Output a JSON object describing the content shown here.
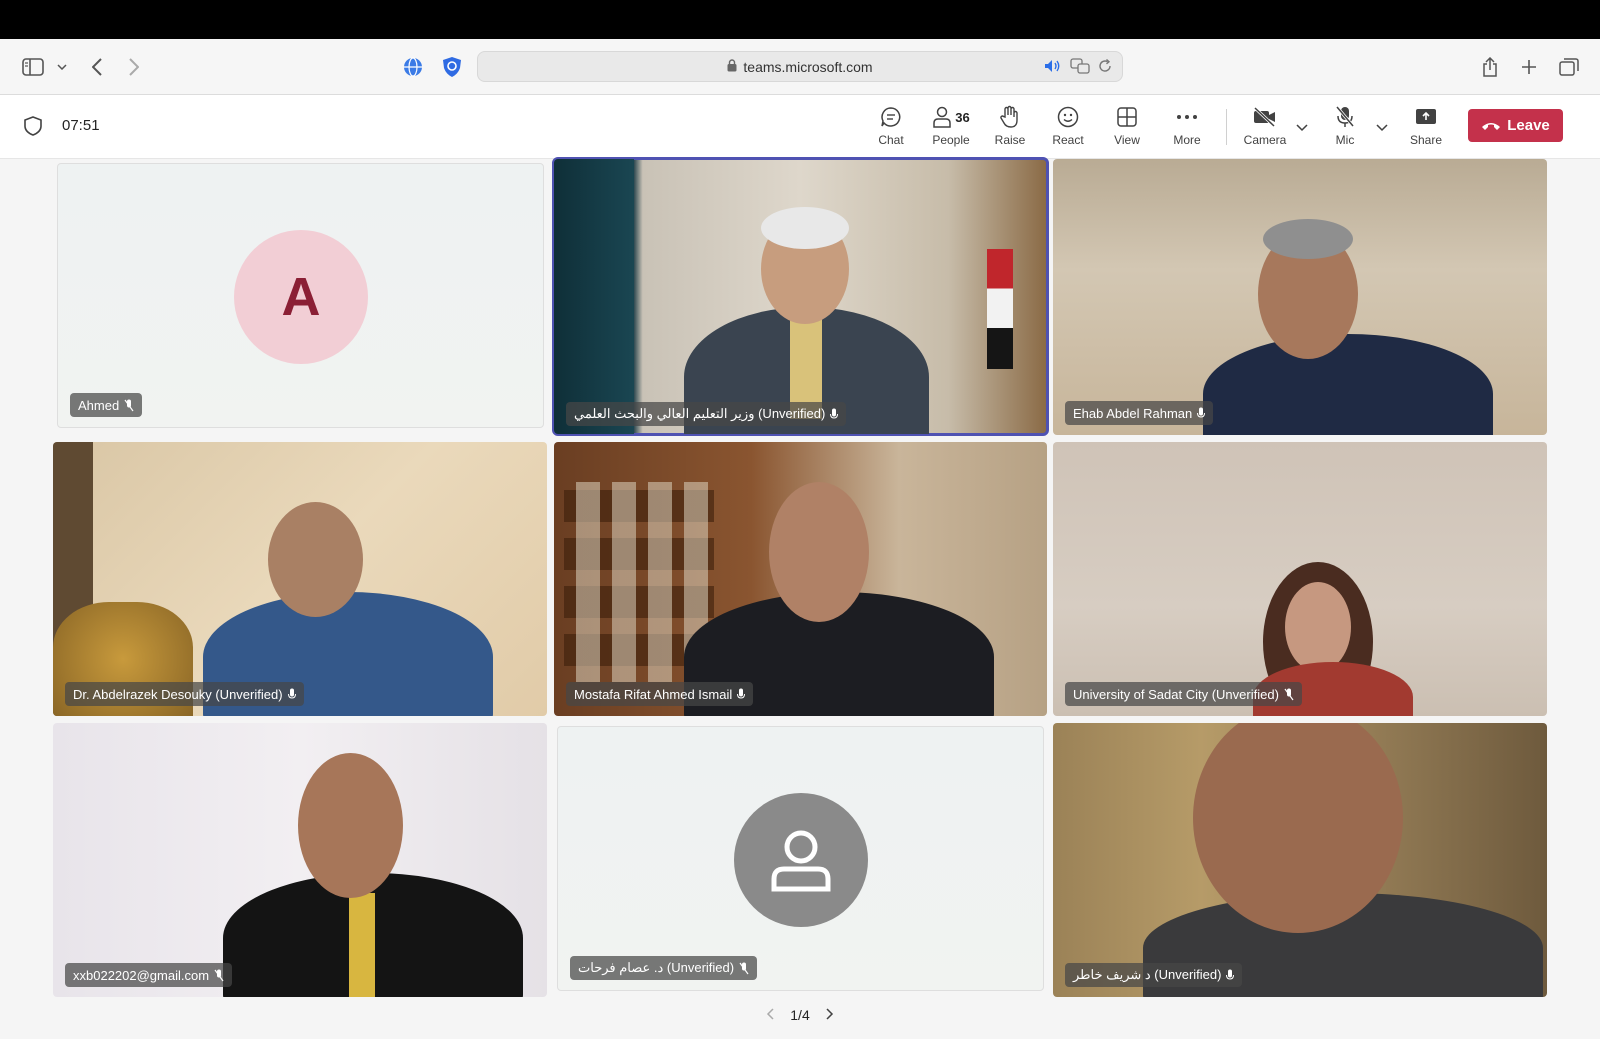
{
  "browser": {
    "url": "teams.microsoft.com"
  },
  "meeting": {
    "timer": "07:51",
    "toolbar": {
      "chat": "Chat",
      "people": "People",
      "people_count": "36",
      "raise": "Raise",
      "react": "React",
      "view": "View",
      "more": "More",
      "camera": "Camera",
      "mic": "Mic",
      "share": "Share",
      "leave": "Leave"
    },
    "accent_color": "#4f52b2",
    "leave_color": "#c4314b"
  },
  "participants": [
    {
      "name": "Ahmed",
      "avatar_initial": "A",
      "muted": true,
      "video": false
    },
    {
      "name": "وزير التعليم العالي والبحث العلمي (Unverified)",
      "muted": false,
      "video": true,
      "active_speaker": true
    },
    {
      "name": "Ehab Abdel Rahman",
      "muted": false,
      "video": true
    },
    {
      "name": "Dr. Abdelrazek Desouky (Unverified)",
      "muted": false,
      "video": true
    },
    {
      "name": "Mostafa Rifat Ahmed Ismail",
      "muted": false,
      "video": true
    },
    {
      "name": "University of Sadat City (Unverified)",
      "muted": true,
      "video": true
    },
    {
      "name": "xxb022202@gmail.com",
      "muted": true,
      "video": true
    },
    {
      "name": "د. عصام فرحات (Unverified)",
      "muted": true,
      "video": false
    },
    {
      "name": "د شريف خاطر (Unverified)",
      "muted": false,
      "video": true
    }
  ],
  "pager": {
    "label": "1/4"
  }
}
